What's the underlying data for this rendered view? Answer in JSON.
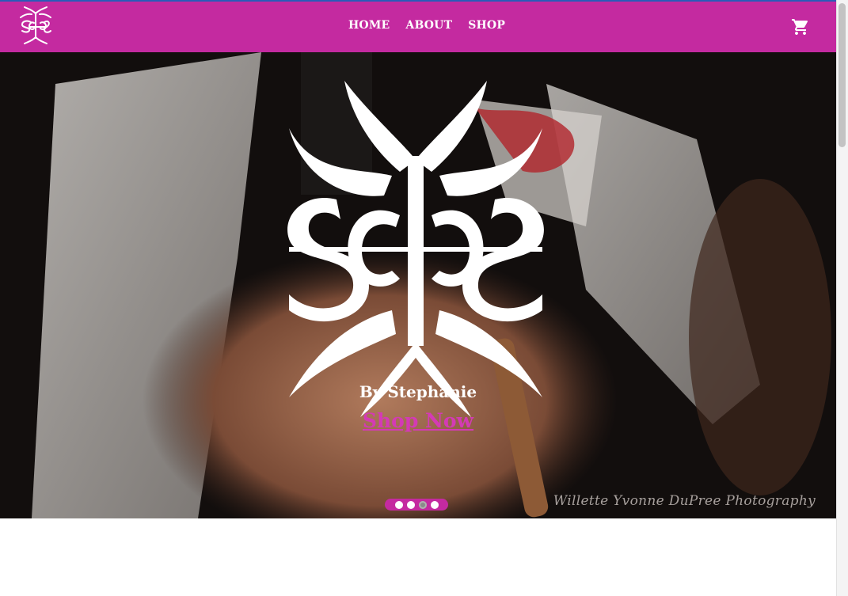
{
  "nav": {
    "links": [
      "HOME",
      "ABOUT",
      "SHOP"
    ]
  },
  "hero": {
    "byline": "By Stephanie",
    "cta": "Shop Now",
    "watermark": "Willette Yvonne DuPree Photography",
    "slides": 4,
    "active_slide": 3
  },
  "colors": {
    "brand": "#c42aa0",
    "cta": "#d43ab5"
  },
  "icons": {
    "logo": "brand-logo-icon",
    "cart": "shopping-cart-icon"
  }
}
